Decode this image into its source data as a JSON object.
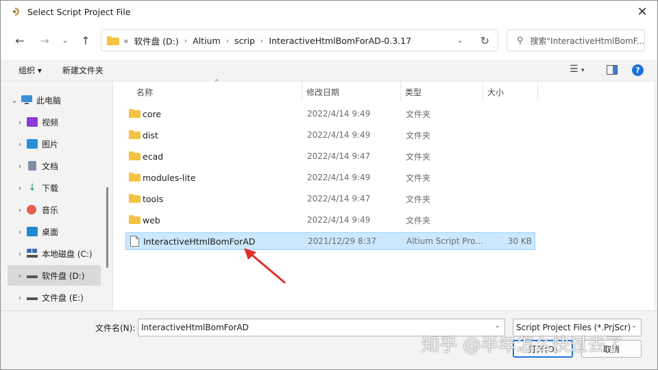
{
  "window": {
    "title": "Select Script Project File"
  },
  "nav": {
    "back_icon": "arrow-left-icon",
    "forward_icon": "arrow-right-icon",
    "recent_icon": "chevron-down-icon",
    "up_icon": "arrow-up-icon"
  },
  "address": {
    "prefix": "«",
    "crumbs": [
      "软件盘 (D:)",
      "Altium",
      "scrip",
      "InteractiveHtmlBomForAD-0.3.17"
    ]
  },
  "search": {
    "placeholder": "搜索\"InteractiveHtmlBomF..."
  },
  "toolbar": {
    "organize": "组织 ▾",
    "new_folder": "新建文件夹"
  },
  "sidebar": {
    "items": [
      {
        "label": "此电脑",
        "icon": "computer-icon",
        "color": "#3b8fd9"
      },
      {
        "label": "视频",
        "icon": "video-icon",
        "color": "#8a3ad6"
      },
      {
        "label": "图片",
        "icon": "pictures-icon",
        "color": "#2a8fd6"
      },
      {
        "label": "文档",
        "icon": "documents-icon",
        "color": "#7f8ea3"
      },
      {
        "label": "下载",
        "icon": "download-icon",
        "color": "#1f9e6e"
      },
      {
        "label": "音乐",
        "icon": "music-icon",
        "color": "#e0624a"
      },
      {
        "label": "桌面",
        "icon": "desktop-icon",
        "color": "#1f88d0"
      },
      {
        "label": "本地磁盘 (C:)",
        "icon": "drive-c-icon",
        "color": "#3a6fb5"
      },
      {
        "label": "软件盘 (D:)",
        "icon": "drive-icon",
        "color": "#555555"
      },
      {
        "label": "文件盘 (E:)",
        "icon": "drive-icon",
        "color": "#555555"
      }
    ]
  },
  "columns": {
    "name": "名称",
    "date": "修改日期",
    "type": "类型",
    "size": "大小"
  },
  "files": [
    {
      "name": "core",
      "date": "2022/4/14 9:49",
      "type": "文件夹",
      "size": "",
      "icon": "folder-icon"
    },
    {
      "name": "dist",
      "date": "2022/4/14 9:49",
      "type": "文件夹",
      "size": "",
      "icon": "folder-icon"
    },
    {
      "name": "ecad",
      "date": "2022/4/14 9:47",
      "type": "文件夹",
      "size": "",
      "icon": "folder-icon"
    },
    {
      "name": "modules-lite",
      "date": "2022/4/14 9:49",
      "type": "文件夹",
      "size": "",
      "icon": "folder-icon"
    },
    {
      "name": "tools",
      "date": "2022/4/14 9:47",
      "type": "文件夹",
      "size": "",
      "icon": "folder-icon"
    },
    {
      "name": "web",
      "date": "2022/4/14 9:49",
      "type": "文件夹",
      "size": "",
      "icon": "folder-icon"
    },
    {
      "name": "InteractiveHtmlBomForAD",
      "date": "2021/12/29 8:37",
      "type": "Altium Script Pro...",
      "size": "30 KB",
      "icon": "file-icon"
    }
  ],
  "footer": {
    "filename_label": "文件名(N):",
    "filename_value": "InteractiveHtmlBomForAD",
    "filetype": "Script Project Files (*.PrjScr)",
    "open_button": "打开(O)",
    "cancel_button": "取消"
  },
  "watermark": "知乎 @半年怎么快过去了",
  "colors": {
    "accent": "#1a73d9",
    "selection": "#cce8ff",
    "annotation_arrow": "#e0312b",
    "folder": "#f5c342"
  }
}
